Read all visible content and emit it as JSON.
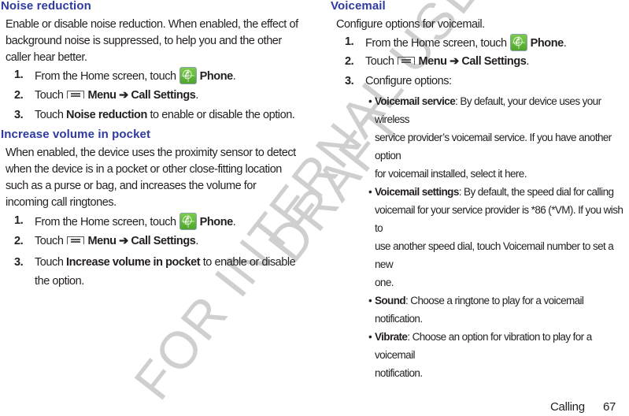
{
  "watermark": {
    "line1": "DRAFT",
    "line2": "FOR INTERNAL USE ONLY",
    "color": "#cfcfcf"
  },
  "colors": {
    "heading": "#2e3a9e",
    "text": "#231f20",
    "phone_icon": "#5cb536"
  },
  "left": {
    "noise": {
      "heading": "Noise reduction",
      "intro": "Enable or disable noise reduction. When enabled, the effect of background noise is suppressed, to help you and the other caller hear better.",
      "steps": [
        {
          "num": "1.",
          "pre": "From the Home screen, touch",
          "icon": "phone-icon",
          "bold": "Phone",
          "post": "."
        },
        {
          "num": "2.",
          "pre": "Touch",
          "icon": "menu-icon",
          "bold": "Menu ➔ Call Settings",
          "post": "."
        },
        {
          "num": "3.",
          "pre": "Touch",
          "bold": "Noise reduction",
          "post": "to enable or disable the option."
        }
      ]
    },
    "pocket": {
      "heading": "Increase volume in pocket",
      "intro_lines": [
        "When enabled, the device uses the proximity sensor to detect",
        "when the device is in a pocket or other close-fitting location",
        "such as a purse or bag, and increases the volume for",
        "incoming call ringtones."
      ],
      "steps": [
        {
          "num": "1.",
          "pre": "From the Home screen, touch",
          "icon": "phone-icon",
          "bold": "Phone",
          "post": "."
        },
        {
          "num": "2.",
          "pre": "Touch",
          "icon": "menu-icon",
          "bold": "Menu ➔ Call Settings",
          "post": "."
        },
        {
          "num": "3.",
          "pre": "Touch",
          "bold": "Increase volume in pocket",
          "post": "to enable or disable",
          "post2": "the option."
        }
      ]
    }
  },
  "right": {
    "voicemail": {
      "heading": "Voicemail",
      "intro": "Configure options for voicemail.",
      "steps": [
        {
          "num": "1.",
          "pre": "From the Home screen, touch",
          "icon": "phone-icon",
          "bold": "Phone",
          "post": "."
        },
        {
          "num": "2.",
          "pre": "Touch",
          "icon": "menu-icon",
          "bold": "Menu ➔ Call Settings",
          "post": "."
        },
        {
          "num": "3.",
          "pre": "Configure options:"
        }
      ],
      "options": [
        {
          "bold": "Voicemail service",
          "lines": [
            ": By default, your device uses your wireless",
            "service provider’s voicemail service. If you have another option",
            "for voicemail installed, select it here."
          ]
        },
        {
          "bold": "Voicemail settings",
          "lines": [
            ": By default, the speed dial for calling",
            "voicemail for your service provider is *86 (*VM). If you wish to",
            "use another speed dial, touch Voicemail number to set a new",
            "one."
          ]
        },
        {
          "bold": "Sound",
          "lines": [
            ": Choose a ringtone to play for a voicemail notification."
          ]
        },
        {
          "bold": "Vibrate",
          "lines": [
            ": Choose an option for vibration to play for a voicemail",
            "notification."
          ]
        }
      ]
    }
  },
  "footer": {
    "section": "Calling",
    "page": "67"
  }
}
